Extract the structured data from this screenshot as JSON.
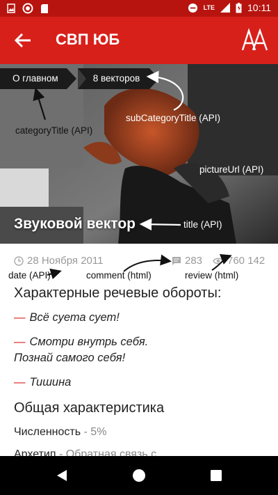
{
  "status_bar": {
    "time": "10:11",
    "network": "LTE"
  },
  "app_bar": {
    "title": "СВП ЮБ",
    "font_size_button_icon": "AA-icon"
  },
  "hero": {
    "breadcrumbs": [
      "О главном",
      "8 векторов"
    ],
    "title": "Звуковой вектор",
    "annotations": {
      "categoryTitle": "categoryTitle (API)",
      "subCategoryTitle": "subCategoryTitle (API)",
      "pictureUrl": "pictureUrl (API)",
      "title": "title (API)"
    }
  },
  "meta": {
    "date": "28 Ноября 2011",
    "comments": "283",
    "views": "760 142",
    "annotations": {
      "date": "date (API)",
      "comment": "comment (html)",
      "review": "review (html)"
    }
  },
  "content": {
    "heading1": "Характерные речевые обороты:",
    "quotes": [
      "Всё суета сует!",
      "Смотри внутрь себя.",
      "Познай самого себя!",
      "Тишина"
    ],
    "heading2": "Общая характеристика",
    "population_label": "Численность",
    "population_value": " - 5%",
    "archetype_label": "Архетип",
    "archetype_value": " - Обратная связь с..."
  },
  "colors": {
    "status_bar": "#b8140f",
    "app_bar": "#d8201b",
    "accent": "#d8201b",
    "meta_text": "#999999"
  }
}
